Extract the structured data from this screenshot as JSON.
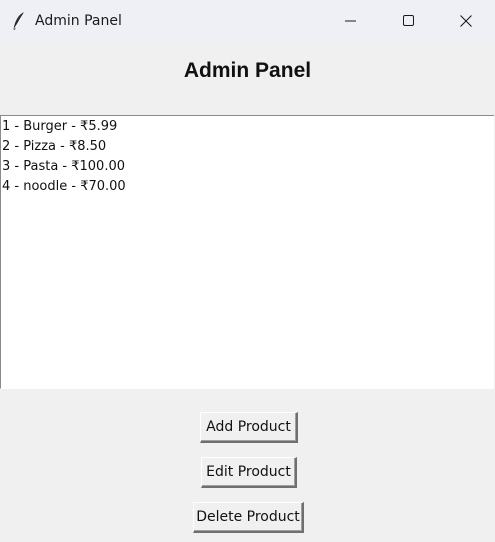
{
  "window": {
    "title": "Admin Panel",
    "icon": "feather-icon"
  },
  "heading": "Admin Panel",
  "products": [
    {
      "label": "1 - Burger - ₹5.99"
    },
    {
      "label": "2 - Pizza - ₹8.50"
    },
    {
      "label": "3 - Pasta - ₹100.00"
    },
    {
      "label": "4 - noodle - ₹70.00"
    }
  ],
  "buttons": {
    "add": "Add Product",
    "edit": "Edit Product",
    "delete": "Delete Product"
  },
  "colors": {
    "titlebar": "#eef0f6",
    "window_bg": "#f0f0f0",
    "list_bg": "#ffffff"
  }
}
